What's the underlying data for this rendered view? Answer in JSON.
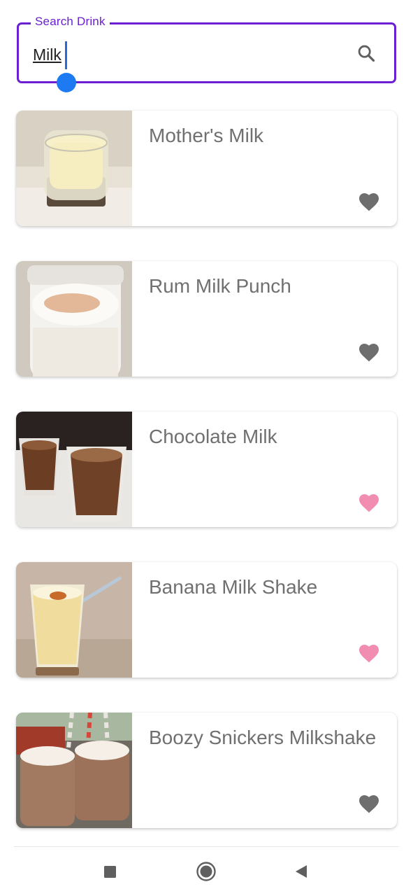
{
  "search": {
    "label": "Search Drink",
    "value": "Milk",
    "icon": "search-icon"
  },
  "colors": {
    "accent": "#6a1fd0",
    "caret": "#1e7af2",
    "favorite": "#f28db2",
    "not_favorite": "#6e6e6e",
    "title_text": "#707070"
  },
  "drinks": [
    {
      "name": "Mother's Milk",
      "favorite": false,
      "image": "glass-of-milk-on-coaster"
    },
    {
      "name": "Rum Milk Punch",
      "favorite": false,
      "image": "jar-with-cinnamon-cream"
    },
    {
      "name": "Chocolate Milk",
      "favorite": true,
      "image": "two-chocolate-shot-glasses"
    },
    {
      "name": "Banana Milk Shake",
      "favorite": true,
      "image": "banana-shake-with-straw"
    },
    {
      "name": "Boozy Snickers Milkshake",
      "favorite": false,
      "image": "snickers-milkshake-jars"
    }
  ],
  "navigation": {
    "recents": "recents-square-icon",
    "home": "home-circle-icon",
    "back": "back-triangle-icon"
  }
}
